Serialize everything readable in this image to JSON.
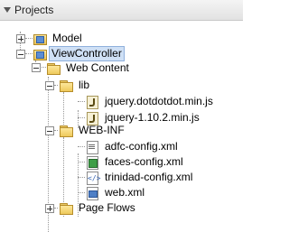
{
  "panel": {
    "title": "Projects"
  },
  "tree": [
    {
      "id": "model",
      "label": "Model",
      "icon": "project-icon",
      "expanded": false
    },
    {
      "id": "viewcontroller",
      "label": "ViewController",
      "icon": "project-icon",
      "expanded": true,
      "selected": true
    },
    {
      "id": "webcontent",
      "label": "Web Content",
      "icon": "folder-icon",
      "expanded": true
    },
    {
      "id": "lib",
      "label": "lib",
      "icon": "folder-icon",
      "expanded": true
    },
    {
      "id": "jquery-dot",
      "label": "jquery.dotdotdot.min.js",
      "icon": "js-file-icon"
    },
    {
      "id": "jquery-main",
      "label": "jquery-1.10.2.min.js",
      "icon": "js-file-icon"
    },
    {
      "id": "webinf",
      "label": "WEB-INF",
      "icon": "folder-icon",
      "expanded": true
    },
    {
      "id": "adfc",
      "label": "adfc-config.xml",
      "icon": "xml-file-icon"
    },
    {
      "id": "faces",
      "label": "faces-config.xml",
      "icon": "faces-config-icon"
    },
    {
      "id": "trinidad",
      "label": "trinidad-config.xml",
      "icon": "trinidad-config-icon"
    },
    {
      "id": "webxml",
      "label": "web.xml",
      "icon": "web-xml-icon"
    },
    {
      "id": "pageflows",
      "label": "Page Flows",
      "icon": "folder-icon",
      "expanded": false
    }
  ]
}
